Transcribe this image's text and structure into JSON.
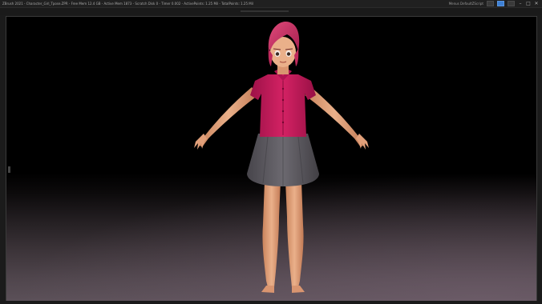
{
  "window": {
    "title": "ZBrush 2021 - Character_Girl_Tpose.ZPR - Free Mem 12.4 GB - Active Mem 1873 - Scratch Disk 0 - Timer 0.002 - ActivePoints: 1.25 Mil - TotalPoints: 1.25 Mil",
    "right_info": "Menus  DefaultZScript",
    "controls": {
      "minimize": "–",
      "maximize": "□",
      "close": "✕"
    }
  },
  "viewport": {
    "background_top": "#000000",
    "background_bottom": "#5b5058"
  },
  "model": {
    "subject": "cartoon girl in T-pose",
    "colors": {
      "hair": "#d2386a",
      "shirt": "#c4185a",
      "skirt": "#5f5c62",
      "skin": "#e8a77c"
    }
  }
}
